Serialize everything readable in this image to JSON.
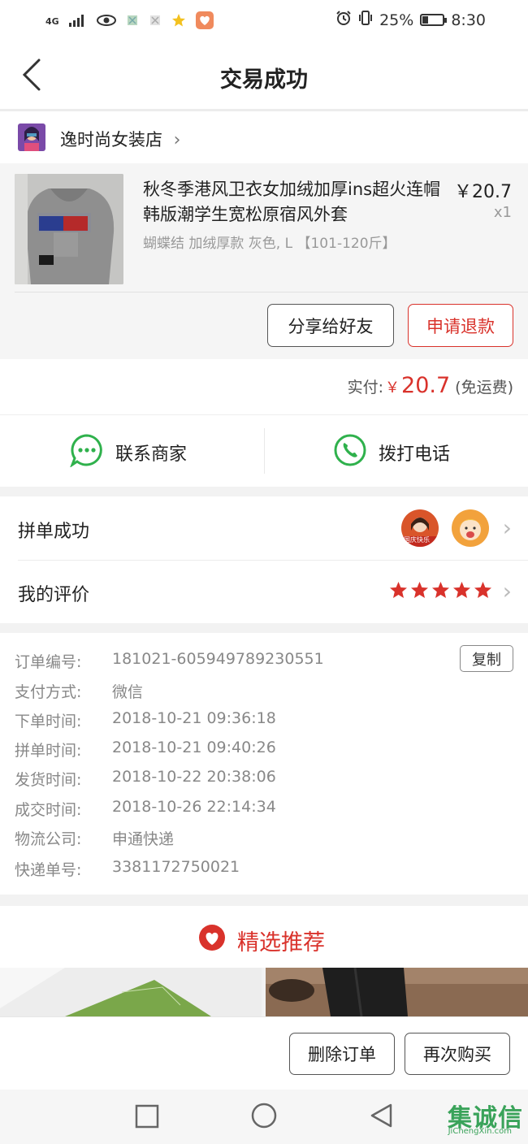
{
  "status_bar": {
    "network": "4G",
    "battery_percent": "25%",
    "time": "8:30",
    "colors": {
      "favorite_star": "#f3c11f",
      "heart_app": "#f08a5d"
    }
  },
  "nav": {
    "title": "交易成功",
    "back_icon": "chevron-left-icon"
  },
  "shop": {
    "name": "逸时尚女装店"
  },
  "product": {
    "title": "秋冬季港风卫衣女加绒加厚ins超火连帽韩版潮学生宽松原宿风外套",
    "spec": "蝴蝶结 加绒厚款 灰色, L 【101-120斤】",
    "price": "￥20.7",
    "quantity": "x1",
    "share_button": "分享给好友",
    "refund_button": "申请退款"
  },
  "payment": {
    "label": "实付:",
    "currency": "￥",
    "amount": "20.7",
    "note": "(免运费)"
  },
  "contact": {
    "merchant": "联系商家",
    "call": "拨打电话"
  },
  "group": {
    "label": "拼单成功",
    "avatar_caption": "国庆快乐"
  },
  "review": {
    "label": "我的评价",
    "stars": 5
  },
  "order_info": {
    "copy_button": "复制",
    "rows": [
      {
        "label": "订单编号:",
        "value": "181021-605949789230551"
      },
      {
        "label": "支付方式:",
        "value": "微信"
      },
      {
        "label": "下单时间:",
        "value": "2018-10-21 09:36:18"
      },
      {
        "label": "拼单时间:",
        "value": "2018-10-21 09:40:26"
      },
      {
        "label": "发货时间:",
        "value": "2018-10-22 20:38:06"
      },
      {
        "label": "成交时间:",
        "value": "2018-10-26 22:14:34"
      },
      {
        "label": "物流公司:",
        "value": "申通快递"
      },
      {
        "label": "快递单号:",
        "value": "3381172750021"
      }
    ]
  },
  "recommend": {
    "title": "精选推荐"
  },
  "actions": {
    "delete": "删除订单",
    "rebuy": "再次购买"
  },
  "watermark": {
    "main": "集诚信",
    "sub": "JiChengXin.com"
  },
  "colors": {
    "accent_red": "#d9322b",
    "wechat_green": "#2fb14c"
  }
}
